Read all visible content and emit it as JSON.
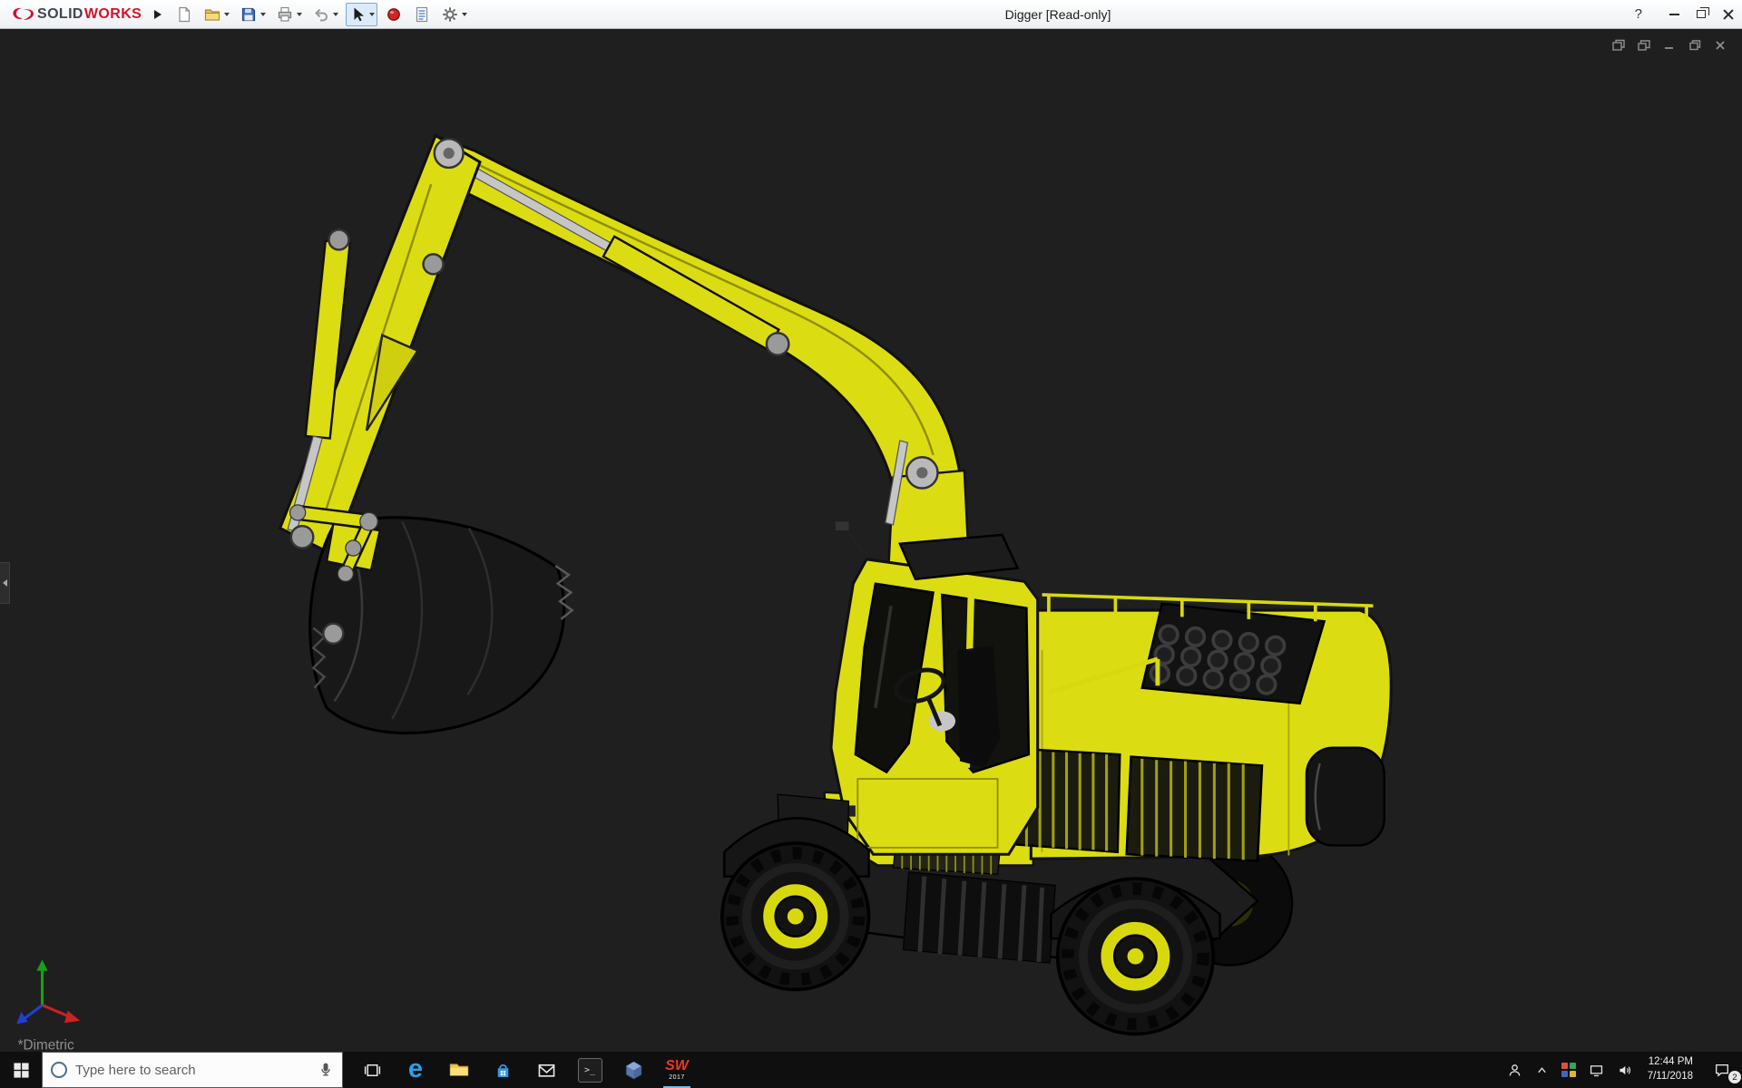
{
  "titlebar": {
    "brand": {
      "prefix": "SOLID",
      "suffix": "WORKS"
    },
    "document_title": "Digger [Read-only]",
    "help_label": "?",
    "toolbar_icons": [
      "new-document",
      "open",
      "save",
      "print",
      "undo",
      "select",
      "rebuild",
      "file-properties",
      "options"
    ],
    "window_controls": [
      "minimize",
      "restore",
      "close"
    ]
  },
  "viewport": {
    "background_color": "#1f1f1f",
    "view_label": "*Dimetric",
    "model": {
      "name": "Digger excavator 3D model",
      "primary_color": "#dcdc12",
      "outline_color": "#111111",
      "hydraulic_rod_color": "#c6c6c6",
      "bucket_color": "#181818"
    },
    "document_window_icons": [
      "window-stack",
      "window-group",
      "doc-minimize",
      "doc-restore",
      "doc-close"
    ],
    "triad_axis_colors": {
      "x": "#d02020",
      "y": "#18a018",
      "z": "#2040d0"
    }
  },
  "taskbar": {
    "search": {
      "placeholder": "Type here to search"
    },
    "edge_glyph": "e",
    "console_glyph": ">_",
    "solidworks_tile": {
      "line1": "SW",
      "line2": "2017"
    },
    "app_icons": [
      "start",
      "cortana-search",
      "task-view",
      "edge",
      "file-explorer",
      "store",
      "mail",
      "console",
      "3d-viewer",
      "solidworks-2017"
    ],
    "tray": {
      "icons": [
        "people",
        "hidden-icons-chevron",
        "tray-app",
        "network",
        "volume",
        "action-center"
      ],
      "clock": {
        "time": "12:44 PM",
        "date": "7/11/2018"
      },
      "action_center_badge": "2"
    }
  }
}
